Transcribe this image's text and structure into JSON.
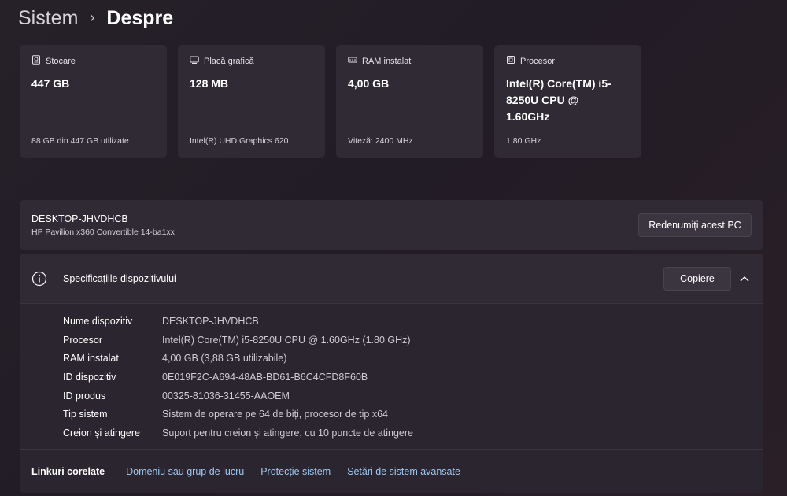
{
  "breadcrumb": {
    "parent": "Sistem",
    "separator": "›",
    "current": "Despre"
  },
  "cards": [
    {
      "icon": "storage-icon",
      "title": "Stocare",
      "value": "447 GB",
      "sub": "88 GB din 447 GB utilizate"
    },
    {
      "icon": "gpu-icon",
      "title": "Placă grafică",
      "value": "128 MB",
      "sub": "Intel(R) UHD Graphics 620"
    },
    {
      "icon": "ram-icon",
      "title": "RAM instalat",
      "value": "4,00 GB",
      "sub": "Viteză: 2400 MHz"
    },
    {
      "icon": "processor-icon",
      "title": "Procesor",
      "value": "Intel(R) Core(TM) i5-8250U CPU @ 1.60GHz",
      "sub": "1.80 GHz"
    }
  ],
  "pc": {
    "name": "DESKTOP-JHVDHCB",
    "model": "HP Pavilion x360 Convertible 14-ba1xx",
    "rename_label": "Redenumiți acest PC"
  },
  "specs": {
    "title": "Specificațiile dispozitivului",
    "copy_label": "Copiere",
    "rows": [
      {
        "label": "Nume dispozitiv",
        "value": "DESKTOP-JHVDHCB"
      },
      {
        "label": "Procesor",
        "value": "Intel(R) Core(TM) i5-8250U CPU @ 1.60GHz (1.80 GHz)"
      },
      {
        "label": "RAM instalat",
        "value": "4,00 GB (3,88 GB utilizabile)"
      },
      {
        "label": "ID dispozitiv",
        "value": "0E019F2C-A694-48AB-BD61-B6C4CFD8F60B"
      },
      {
        "label": "ID produs",
        "value": "00325-81036-31455-AAOEM"
      },
      {
        "label": "Tip sistem",
        "value": "Sistem de operare pe 64 de biți, procesor de tip x64"
      },
      {
        "label": "Creion și atingere",
        "value": "Suport pentru creion și atingere, cu 10 puncte de atingere"
      }
    ]
  },
  "related_links": {
    "title": "Linkuri corelate",
    "links": [
      "Domeniu sau grup de lucru",
      "Protecție sistem",
      "Setări de sistem avansate"
    ]
  },
  "colors": {
    "link": "#9cc9f2",
    "panel": "#2f2a33",
    "background": "#241e28"
  }
}
